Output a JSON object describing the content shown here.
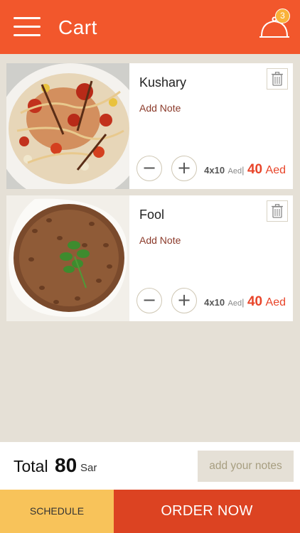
{
  "header": {
    "title": "Cart",
    "menu_icon": "hamburger-menu-icon",
    "cart_icon": "cloche-icon",
    "cart_count": "3"
  },
  "items": [
    {
      "name": "Kushary",
      "note_label": "Add Note",
      "image": "kushary-food-photo",
      "delete_icon": "trash-icon",
      "minus_label": "−",
      "plus_label": "+",
      "qty": "4x10",
      "unit": "Aed",
      "sep": "|",
      "price": "40",
      "currency": "Aed"
    },
    {
      "name": "Fool",
      "note_label": "Add Note",
      "image": "fool-food-photo",
      "delete_icon": "trash-icon",
      "minus_label": "−",
      "plus_label": "+",
      "qty": "4x10",
      "unit": "Aed",
      "sep": "|",
      "price": "40",
      "currency": "Aed"
    }
  ],
  "footer": {
    "total_label": "Total",
    "total_value": "80",
    "total_currency": "Sar",
    "notes_button": "add your notes"
  },
  "actions": {
    "schedule_label": "SCHEDULE",
    "order_label": "ORDER NOW"
  },
  "colors": {
    "header": "#f2572c",
    "background": "#e5e0d6",
    "schedule": "#f8c35a",
    "order": "#dc4322",
    "price": "#e8452a",
    "note": "#8b3a2a"
  }
}
